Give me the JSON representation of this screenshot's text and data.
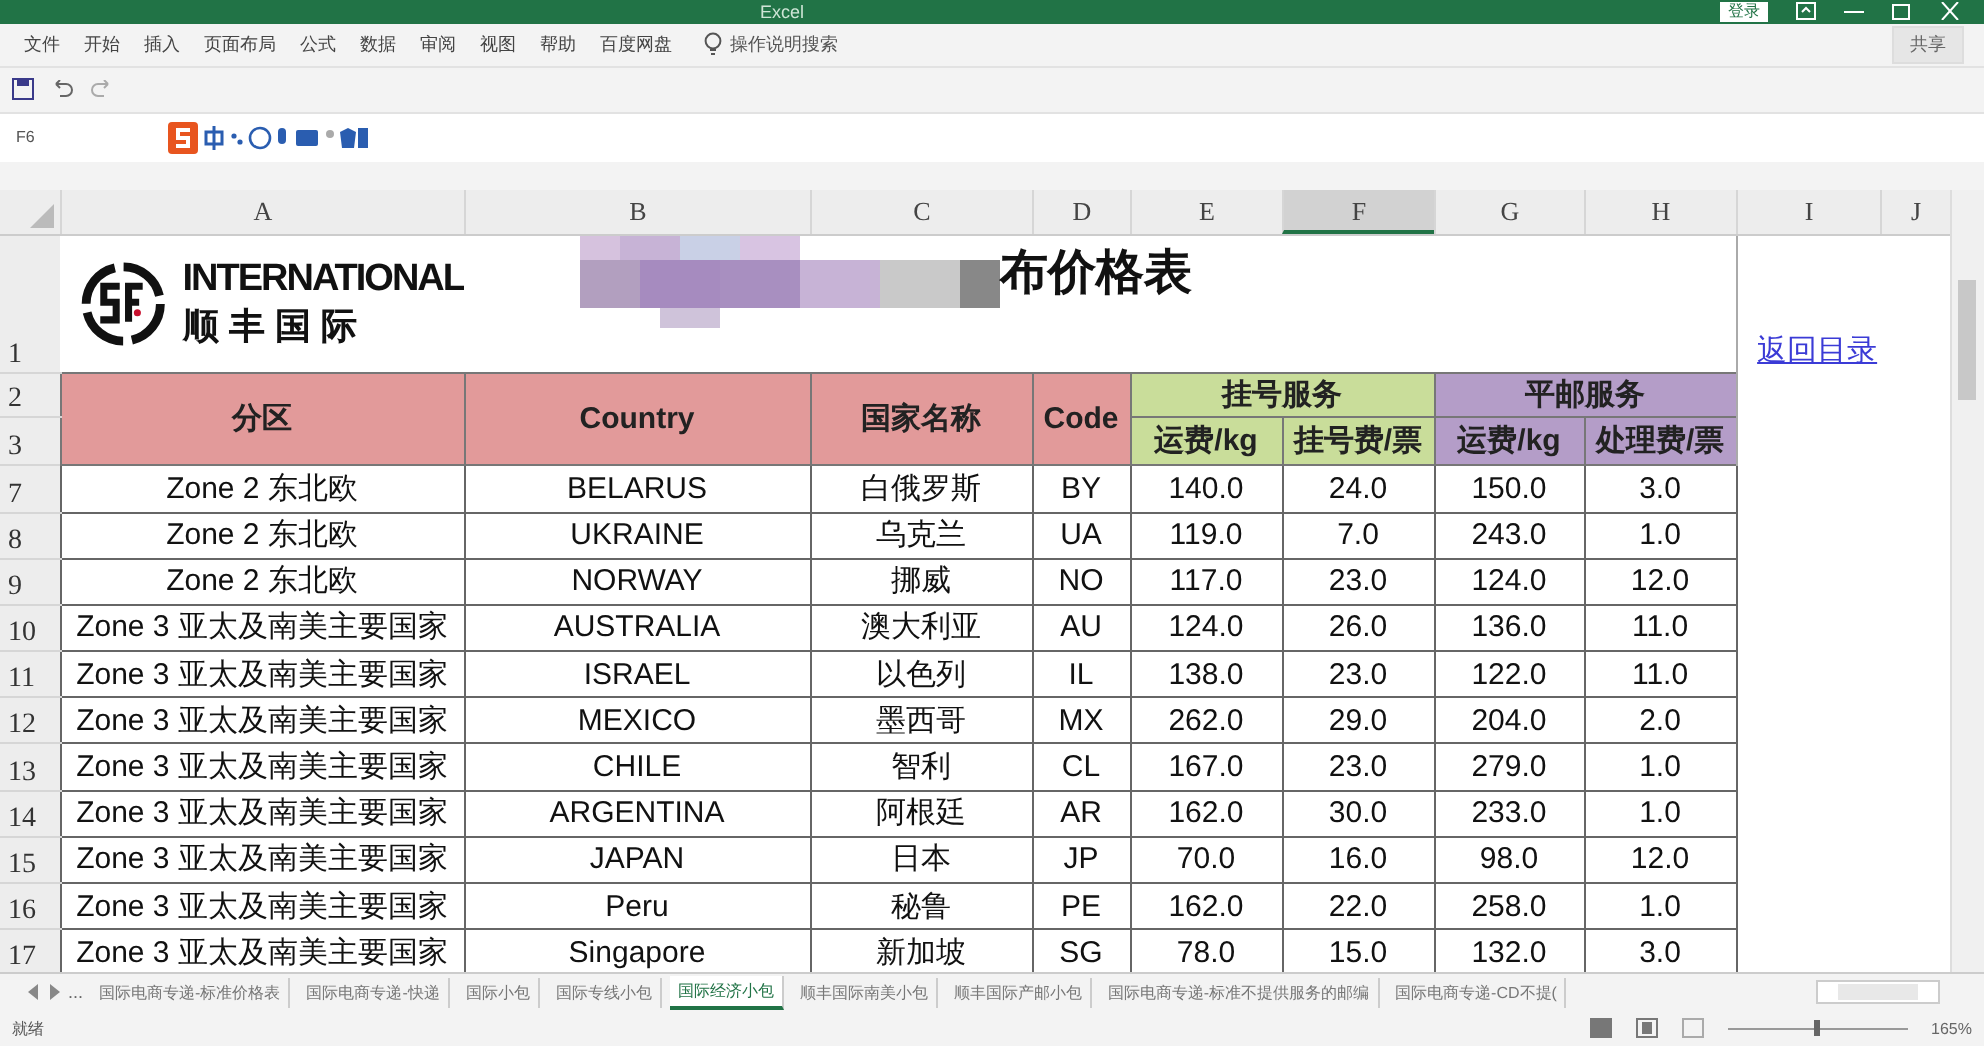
{
  "window": {
    "title": "Excel",
    "account_button": "登录"
  },
  "menu": [
    "文件",
    "开始",
    "插入",
    "页面布局",
    "公式",
    "数据",
    "审阅",
    "视图",
    "帮助",
    "百度网盘"
  ],
  "tell_me": "操作说明搜索",
  "share_button": "共享",
  "name_box": "F6",
  "columns": [
    {
      "label": "A",
      "selected": false
    },
    {
      "label": "B",
      "selected": false
    },
    {
      "label": "C",
      "selected": false
    },
    {
      "label": "D",
      "selected": false
    },
    {
      "label": "E",
      "selected": false
    },
    {
      "label": "F",
      "selected": true
    },
    {
      "label": "G",
      "selected": false
    },
    {
      "label": "H",
      "selected": false
    },
    {
      "label": "I",
      "selected": false
    },
    {
      "label": "J",
      "selected": false
    }
  ],
  "sheet": {
    "title": "布价格表",
    "link": "返回目录",
    "logo_text": "INTERNATIONAL",
    "logo_cn": "顺 丰 国 际",
    "header_rows": [
      "1",
      "2",
      "3"
    ],
    "headers": {
      "zone": "分区",
      "country": "Country",
      "name": "国家名称",
      "code": "Code",
      "registered": "挂号服务",
      "standard": "平邮服务",
      "reg_rate": "运费/kg",
      "reg_fee": "挂号费/票",
      "std_rate": "运费/kg",
      "std_fee": "处理费/票"
    },
    "rows": [
      {
        "row": "7",
        "zone": "Zone 2 东北欧",
        "country": "BELARUS",
        "name": "白俄罗斯",
        "code": "BY",
        "reg_rate": "140.0",
        "reg_fee": "24.0",
        "std_rate": "150.0",
        "std_fee": "3.0"
      },
      {
        "row": "8",
        "zone": "Zone 2 东北欧",
        "country": "UKRAINE",
        "name": "乌克兰",
        "code": "UA",
        "reg_rate": "119.0",
        "reg_fee": "7.0",
        "std_rate": "243.0",
        "std_fee": "1.0"
      },
      {
        "row": "9",
        "zone": "Zone 2 东北欧",
        "country": "NORWAY",
        "name": "挪威",
        "code": "NO",
        "reg_rate": "117.0",
        "reg_fee": "23.0",
        "std_rate": "124.0",
        "std_fee": "12.0"
      },
      {
        "row": "10",
        "zone": "Zone 3 亚太及南美主要国家",
        "country": "AUSTRALIA",
        "name": "澳大利亚",
        "code": "AU",
        "reg_rate": "124.0",
        "reg_fee": "26.0",
        "std_rate": "136.0",
        "std_fee": "11.0"
      },
      {
        "row": "11",
        "zone": "Zone 3 亚太及南美主要国家",
        "country": "ISRAEL",
        "name": "以色列",
        "code": "IL",
        "reg_rate": "138.0",
        "reg_fee": "23.0",
        "std_rate": "122.0",
        "std_fee": "11.0"
      },
      {
        "row": "12",
        "zone": "Zone 3 亚太及南美主要国家",
        "country": "MEXICO",
        "name": "墨西哥",
        "code": "MX",
        "reg_rate": "262.0",
        "reg_fee": "29.0",
        "std_rate": "204.0",
        "std_fee": "2.0"
      },
      {
        "row": "13",
        "zone": "Zone 3 亚太及南美主要国家",
        "country": "CHILE",
        "name": "智利",
        "code": "CL",
        "reg_rate": "167.0",
        "reg_fee": "23.0",
        "std_rate": "279.0",
        "std_fee": "1.0"
      },
      {
        "row": "14",
        "zone": "Zone 3 亚太及南美主要国家",
        "country": "ARGENTINA",
        "name": "阿根廷",
        "code": "AR",
        "reg_rate": "162.0",
        "reg_fee": "30.0",
        "std_rate": "233.0",
        "std_fee": "1.0"
      },
      {
        "row": "15",
        "zone": "Zone 3 亚太及南美主要国家",
        "country": "JAPAN",
        "name": "日本",
        "code": "JP",
        "reg_rate": "70.0",
        "reg_fee": "16.0",
        "std_rate": "98.0",
        "std_fee": "12.0"
      },
      {
        "row": "16",
        "zone": "Zone 3 亚太及南美主要国家",
        "country": "Peru",
        "name": "秘鲁",
        "code": "PE",
        "reg_rate": "162.0",
        "reg_fee": "22.0",
        "std_rate": "258.0",
        "std_fee": "1.0"
      },
      {
        "row": "17",
        "zone": "Zone 3 亚太及南美主要国家",
        "country": "Singapore",
        "name": "新加坡",
        "code": "SG",
        "reg_rate": "78.0",
        "reg_fee": "15.0",
        "std_rate": "132.0",
        "std_fee": "3.0"
      }
    ]
  },
  "sheet_tabs": [
    {
      "label": "国际电商专递-标准价格表",
      "selected": false
    },
    {
      "label": "国际电商专递-快递",
      "selected": false
    },
    {
      "label": "国际小包",
      "selected": false
    },
    {
      "label": "国际专线小包",
      "selected": false
    },
    {
      "label": "国际经济小包",
      "selected": true
    },
    {
      "label": "顺丰国际南美小包",
      "selected": false
    },
    {
      "label": "顺丰国际产邮小包",
      "selected": false
    },
    {
      "label": "国际电商专递-标准不提供服务的邮编",
      "selected": false
    },
    {
      "label": "国际电商专递-CD不提(",
      "selected": false
    }
  ],
  "more_tabs": "...",
  "status": "就绪",
  "zoom": "165%",
  "zoom_slider": {
    "level": 0.5
  }
}
